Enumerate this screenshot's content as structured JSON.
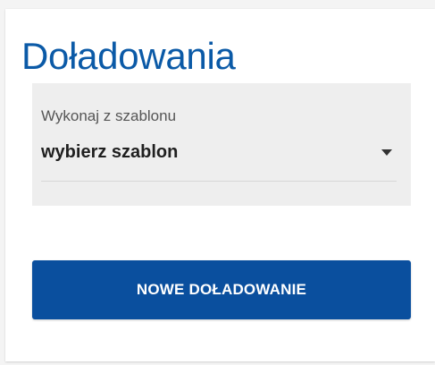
{
  "topup": {
    "title": "Doładowania",
    "template_select": {
      "label": "Wykonaj z szablonu",
      "selected_value": "wybierz szablon",
      "icon": "chevron-down-icon"
    },
    "new_topup_button": "NOWE DOŁADOWANIE"
  },
  "colors": {
    "title": "#0b5aa7",
    "button_background": "#0a4f9e",
    "select_background": "#eeeeee",
    "chevron": "#333333"
  }
}
